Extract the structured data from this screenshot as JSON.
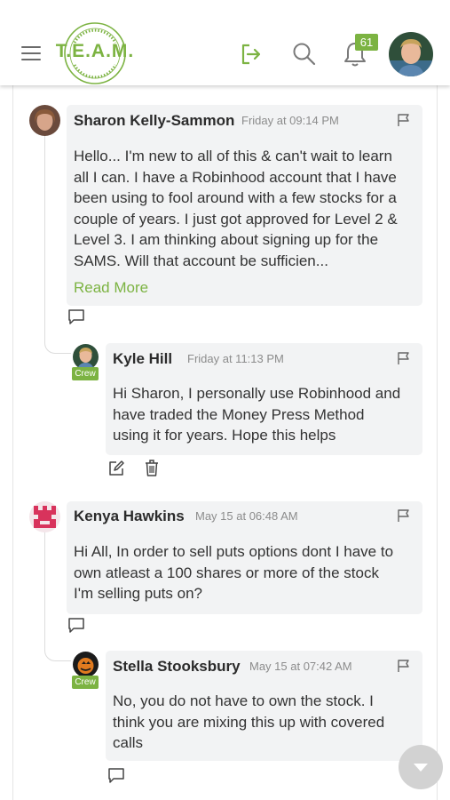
{
  "header": {
    "logo_text": "T.E.A.M.",
    "logo_ring_text": "Money Press Method",
    "notification_count": "61",
    "icons": {
      "menu": "hamburger-menu-icon",
      "logout": "logout-arrow-icon",
      "search": "search-icon",
      "notifications": "bell-icon",
      "profile": "user-avatar"
    },
    "accent_color": "#7cb342"
  },
  "comments": [
    {
      "author": "Sharon Kelly-Sammon",
      "time": "Friday at 09:14 PM",
      "lines": [
        "Hello... I'm new to all of this & can't wait to learn",
        "all I can. I have a Robinhood account that I have",
        "been using to fool around with a few stocks for a",
        "couple of years. I just got approved for Level 2 &",
        "Level 3. I am thinking about signing up for the",
        "SAMS. Will that account be sufficien..."
      ],
      "read_more": "Read More",
      "reply": {
        "author": "Kyle Hill",
        "badge": "Crew",
        "time": "Friday at 11:13 PM",
        "lines": [
          "Hi Sharon, I personally use Robinhood and",
          "have traded the Money Press Method",
          "using it for years. Hope this helps"
        ]
      }
    },
    {
      "author": "Kenya Hawkins",
      "time": "May 15 at 06:48 AM",
      "lines": [
        "Hi All, In order to sell puts options dont I have to",
        "own atleast a 100 shares or more of the stock",
        "I'm selling puts on?"
      ],
      "reply": {
        "author": "Stella Stooksbury",
        "badge": "Crew",
        "time": "May 15 at 07:42 AM",
        "lines": [
          "No, you do not have to own the stock. I",
          "think you are mixing this up with covered",
          "calls"
        ]
      }
    }
  ]
}
